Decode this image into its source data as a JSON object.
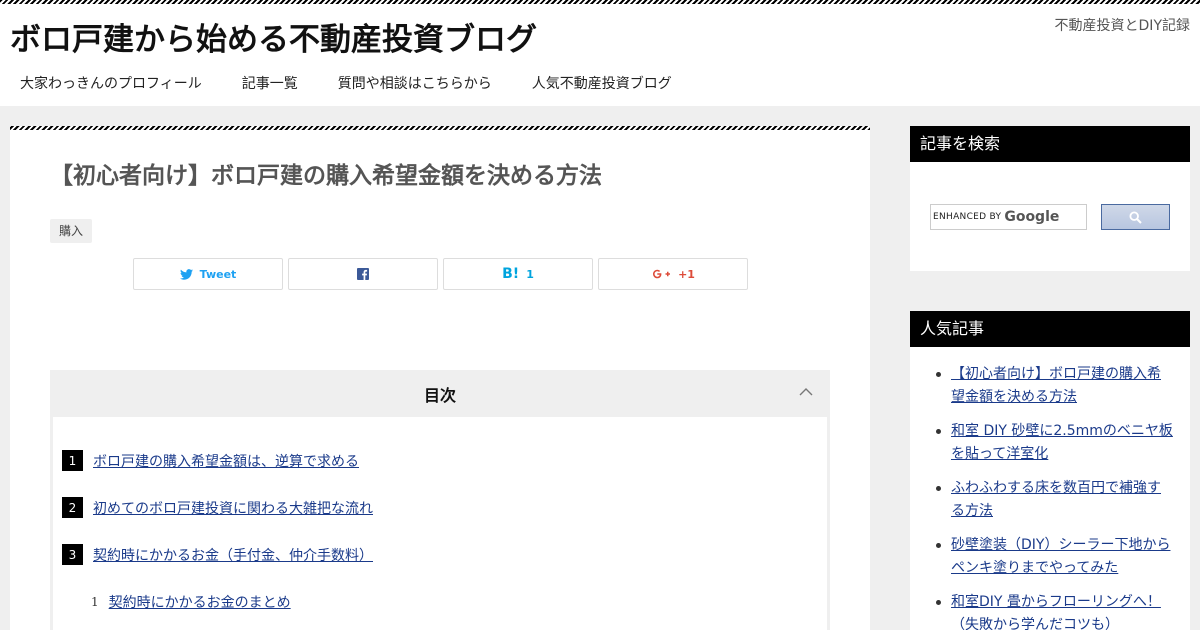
{
  "header": {
    "site_title": "ボロ戸建から始める不動産投資ブログ",
    "site_description": "不動産投資とDIY記録",
    "nav": [
      "大家わっきんのプロフィール",
      "記事一覧",
      "質問や相談はこちらから",
      "人気不動産投資ブログ"
    ]
  },
  "post": {
    "title": "【初心者向け】ボロ戸建の購入希望金額を決める方法",
    "category": "購入",
    "share": {
      "tweet_label": "Tweet",
      "hatena_label": "B!",
      "hatena_count": "1",
      "gplus_label": "+1"
    }
  },
  "toc": {
    "title": "目次",
    "items": [
      {
        "num": "1",
        "label": "ボロ戸建の購入希望金額は、逆算で求める"
      },
      {
        "num": "2",
        "label": "初めてのボロ戸建投資に関わる大雑把な流れ"
      },
      {
        "num": "3",
        "label": "契約時にかかるお金（手付金、仲介手数料）"
      }
    ],
    "sub_items": [
      {
        "num": "1",
        "label": "契約時にかかるお金のまとめ"
      }
    ]
  },
  "sidebar": {
    "search_title": "記事を検索",
    "search_enhanced": "ENHANCED BY",
    "search_google": "Google",
    "popular_title": "人気記事",
    "popular": [
      "【初心者向け】ボロ戸建の購入希望金額を決める方法",
      "和室 DIY 砂壁に2.5mmのベニヤ板を貼って洋室化",
      "ふわふわする床を数百円で補強する方法",
      "砂壁塗装（DIY）シーラー下地からペンキ塗りまでやってみた",
      "和室DIY 畳からフローリングへ！（失敗から学んだコツも）"
    ]
  },
  "colors": {
    "link": "#1a3a8a",
    "twitter": "#1da1f2",
    "facebook": "#3b5998",
    "hatena": "#00a4de",
    "gplus": "#dd4b39"
  }
}
